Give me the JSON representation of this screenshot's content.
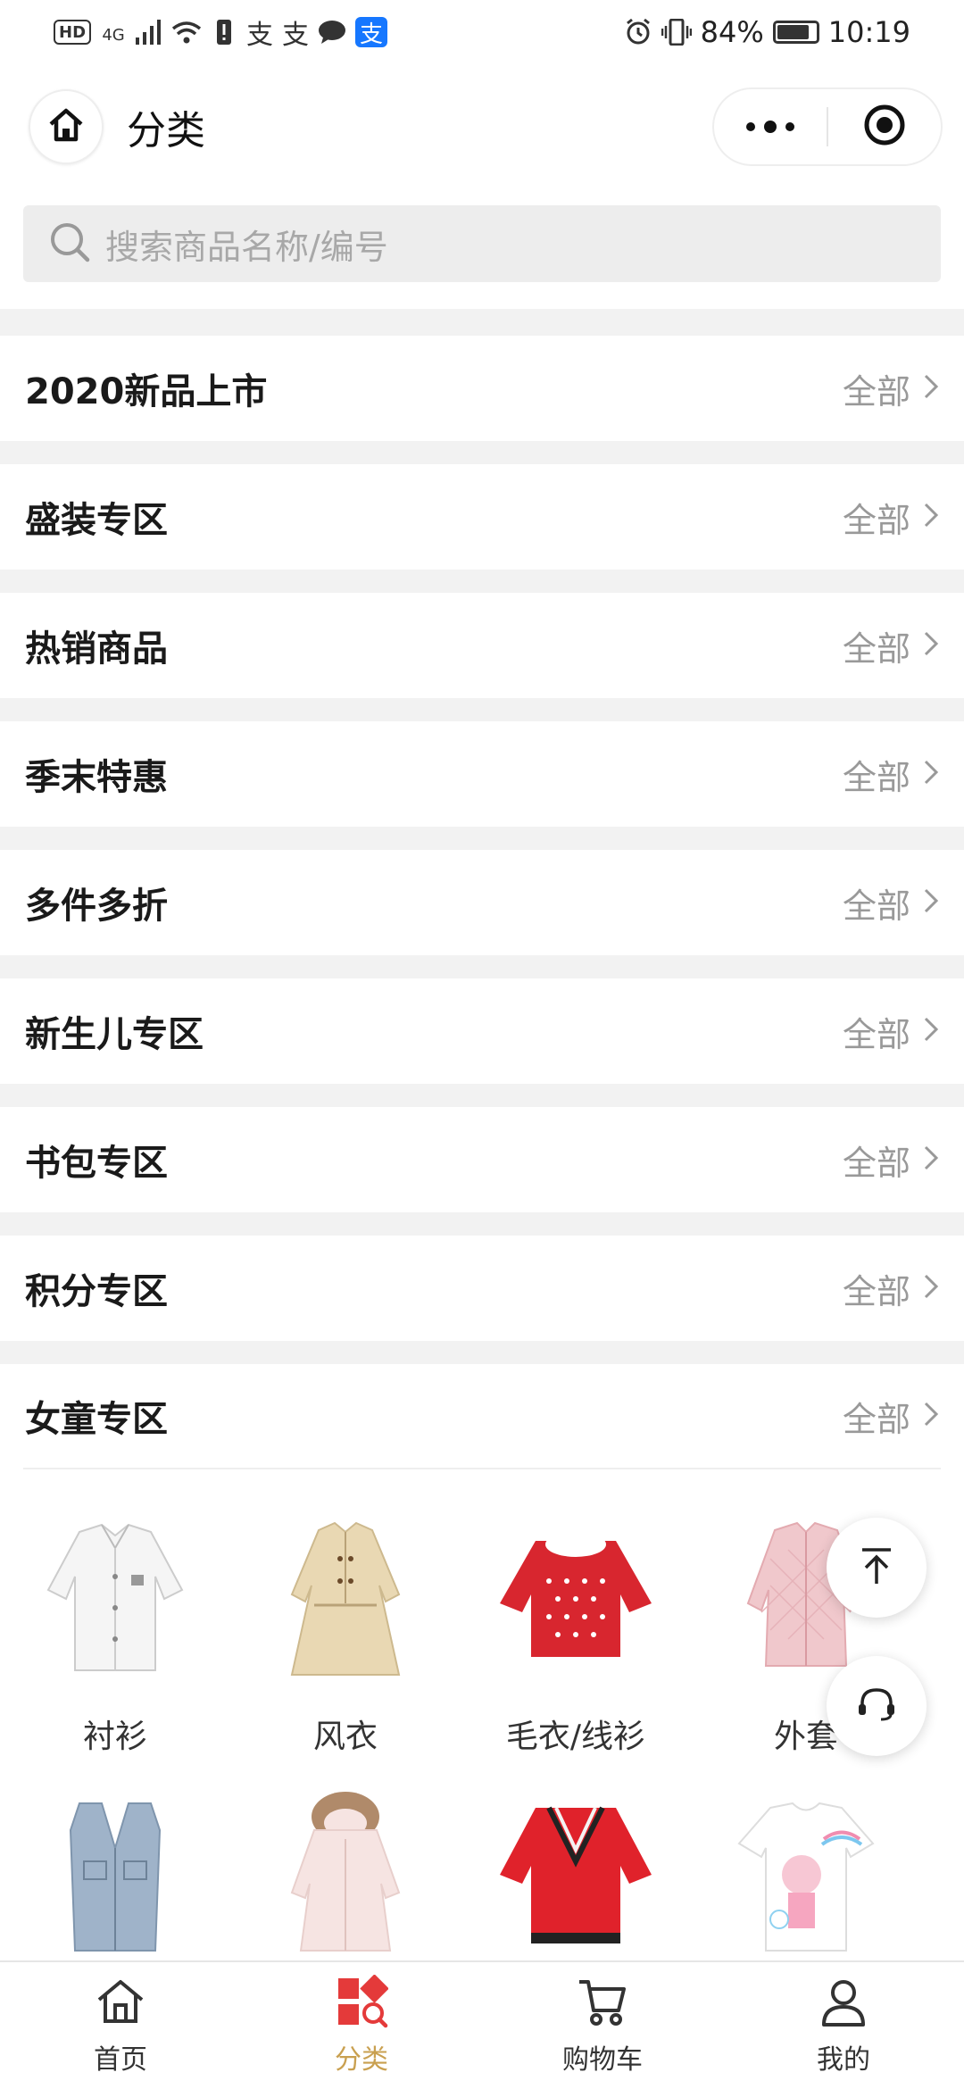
{
  "status_bar": {
    "network": "4G",
    "hd": "HD",
    "alipay_1": "支",
    "alipay_2": "支",
    "alipay_3": "支",
    "battery": "84%",
    "time": "10:19"
  },
  "header": {
    "title": "分类"
  },
  "search": {
    "placeholder": "搜索商品名称/编号"
  },
  "categories": [
    {
      "name": "2020新品上市",
      "all": "全部"
    },
    {
      "name": "盛装专区",
      "all": "全部"
    },
    {
      "name": "热销商品",
      "all": "全部"
    },
    {
      "name": "季末特惠",
      "all": "全部"
    },
    {
      "name": "多件多折",
      "all": "全部"
    },
    {
      "name": "新生儿专区",
      "all": "全部"
    },
    {
      "name": "书包专区",
      "all": "全部"
    },
    {
      "name": "积分专区",
      "all": "全部"
    }
  ],
  "girls_section": {
    "name": "女童专区",
    "all": "全部",
    "items": [
      {
        "label": "衬衫",
        "color": "#f4f4f4",
        "icon": "shirt-icon"
      },
      {
        "label": "风衣",
        "color": "#e9d8b3",
        "icon": "trench-coat-icon"
      },
      {
        "label": "毛衣/线衫",
        "color": "#d8262f",
        "icon": "sweater-icon"
      },
      {
        "label": "外套",
        "color": "#f0c8cc",
        "icon": "jacket-icon"
      },
      {
        "label": "",
        "color": "#9fb3c9",
        "icon": "denim-vest-icon"
      },
      {
        "label": "",
        "color": "#f6e4e2",
        "icon": "fur-hood-coat-icon"
      },
      {
        "label": "",
        "color": "#e0222b",
        "icon": "red-sweater-icon"
      },
      {
        "label": "",
        "color": "#ffffff",
        "icon": "tshirt-icon"
      }
    ]
  },
  "tabbar": [
    {
      "label": "首页",
      "icon": "home-icon",
      "active": false
    },
    {
      "label": "分类",
      "icon": "category-icon",
      "active": true
    },
    {
      "label": "购物车",
      "icon": "cart-icon",
      "active": false
    },
    {
      "label": "我的",
      "icon": "user-icon",
      "active": false
    }
  ],
  "colors": {
    "accent": "#c9a050",
    "category_red": "#e43a3a"
  }
}
